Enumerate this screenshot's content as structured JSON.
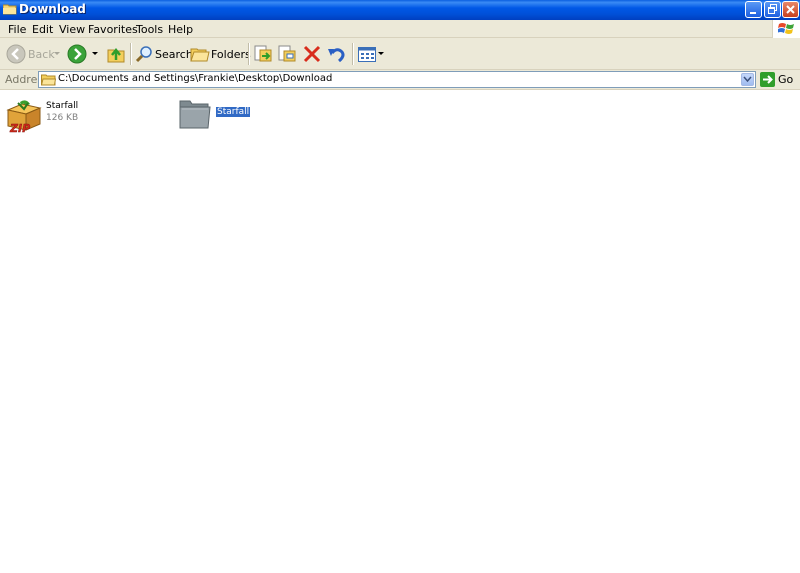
{
  "window": {
    "title": "Download"
  },
  "menu": [
    "File",
    "Edit",
    "View",
    "Favorites",
    "Tools",
    "Help"
  ],
  "toolbar": {
    "back_label": "Back",
    "search_label": "Search",
    "folders_label": "Folders"
  },
  "address": {
    "label": "Address",
    "path": "C:\\Documents and Settings\\Frankie\\Desktop\\Download",
    "go_label": "Go"
  },
  "files": [
    {
      "name": "Starfall",
      "detail": "126 KB",
      "icon": "zip-folder-icon"
    },
    {
      "name": "Starfall",
      "detail": "",
      "icon": "folder-icon",
      "selected": true
    }
  ],
  "colors": {
    "titlebar": "#0058e6",
    "selection": "#316ac5",
    "chrome": "#ece9d8"
  }
}
